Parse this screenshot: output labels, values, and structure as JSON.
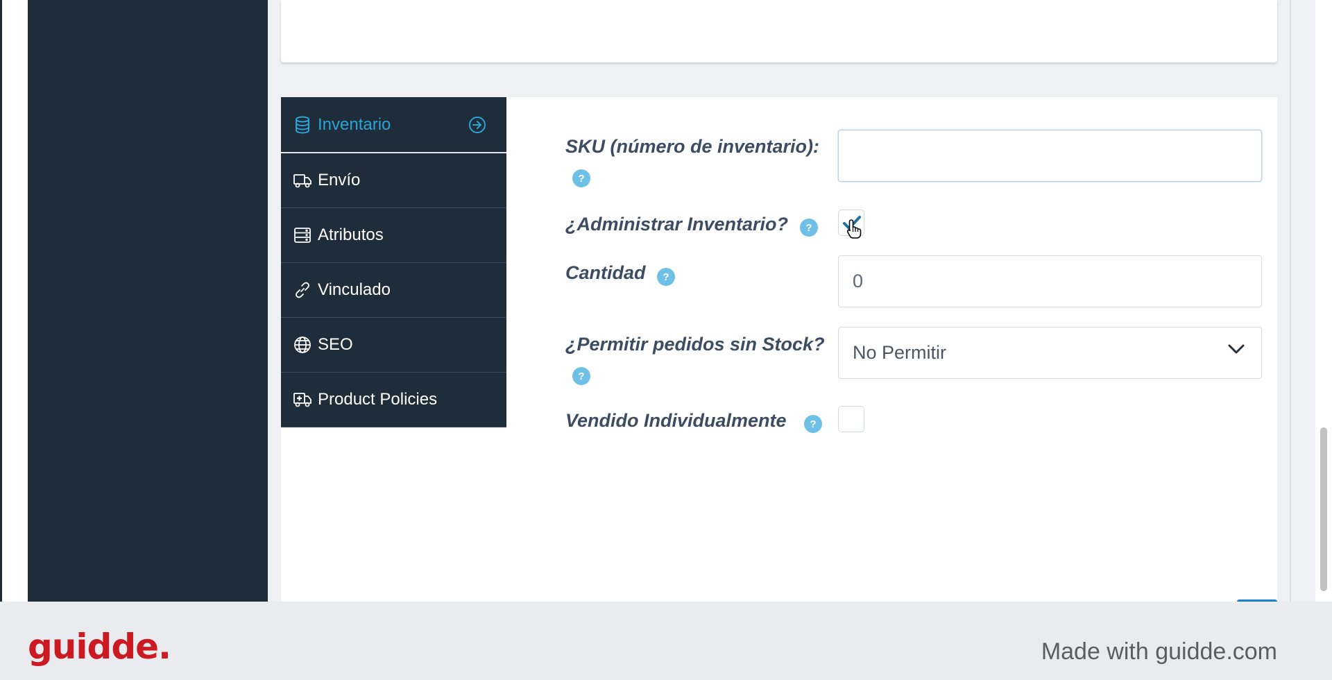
{
  "tabs": [
    {
      "label": "Inventario",
      "icon": "database-icon",
      "active": true
    },
    {
      "label": "Envío",
      "icon": "truck-icon"
    },
    {
      "label": "Atributos",
      "icon": "server-icon"
    },
    {
      "label": "Vinculado",
      "icon": "link-icon"
    },
    {
      "label": "SEO",
      "icon": "globe-icon"
    },
    {
      "label": "Product Policies",
      "icon": "ambulance-icon"
    }
  ],
  "form": {
    "sku_label": "SKU (número de inventario):",
    "sku_value": "",
    "manage_stock_label": "¿Administrar Inventario?",
    "manage_stock_checked": true,
    "quantity_label": "Cantidad",
    "quantity_value": "0",
    "backorders_label": "¿Permitir pedidos sin Stock?",
    "backorders_value": "No Permitir",
    "sold_individually_label": "Vendido Individualmente",
    "sold_individually_checked": false,
    "help_glyph": "?"
  },
  "footer": {
    "logo_text": "guidde.",
    "made_with": "Made with guidde.com"
  },
  "colors": {
    "accent": "#2aa3d6",
    "sidebar": "#1f2d3a",
    "help": "#6ec0e6",
    "brand_red": "#cb1a22"
  }
}
